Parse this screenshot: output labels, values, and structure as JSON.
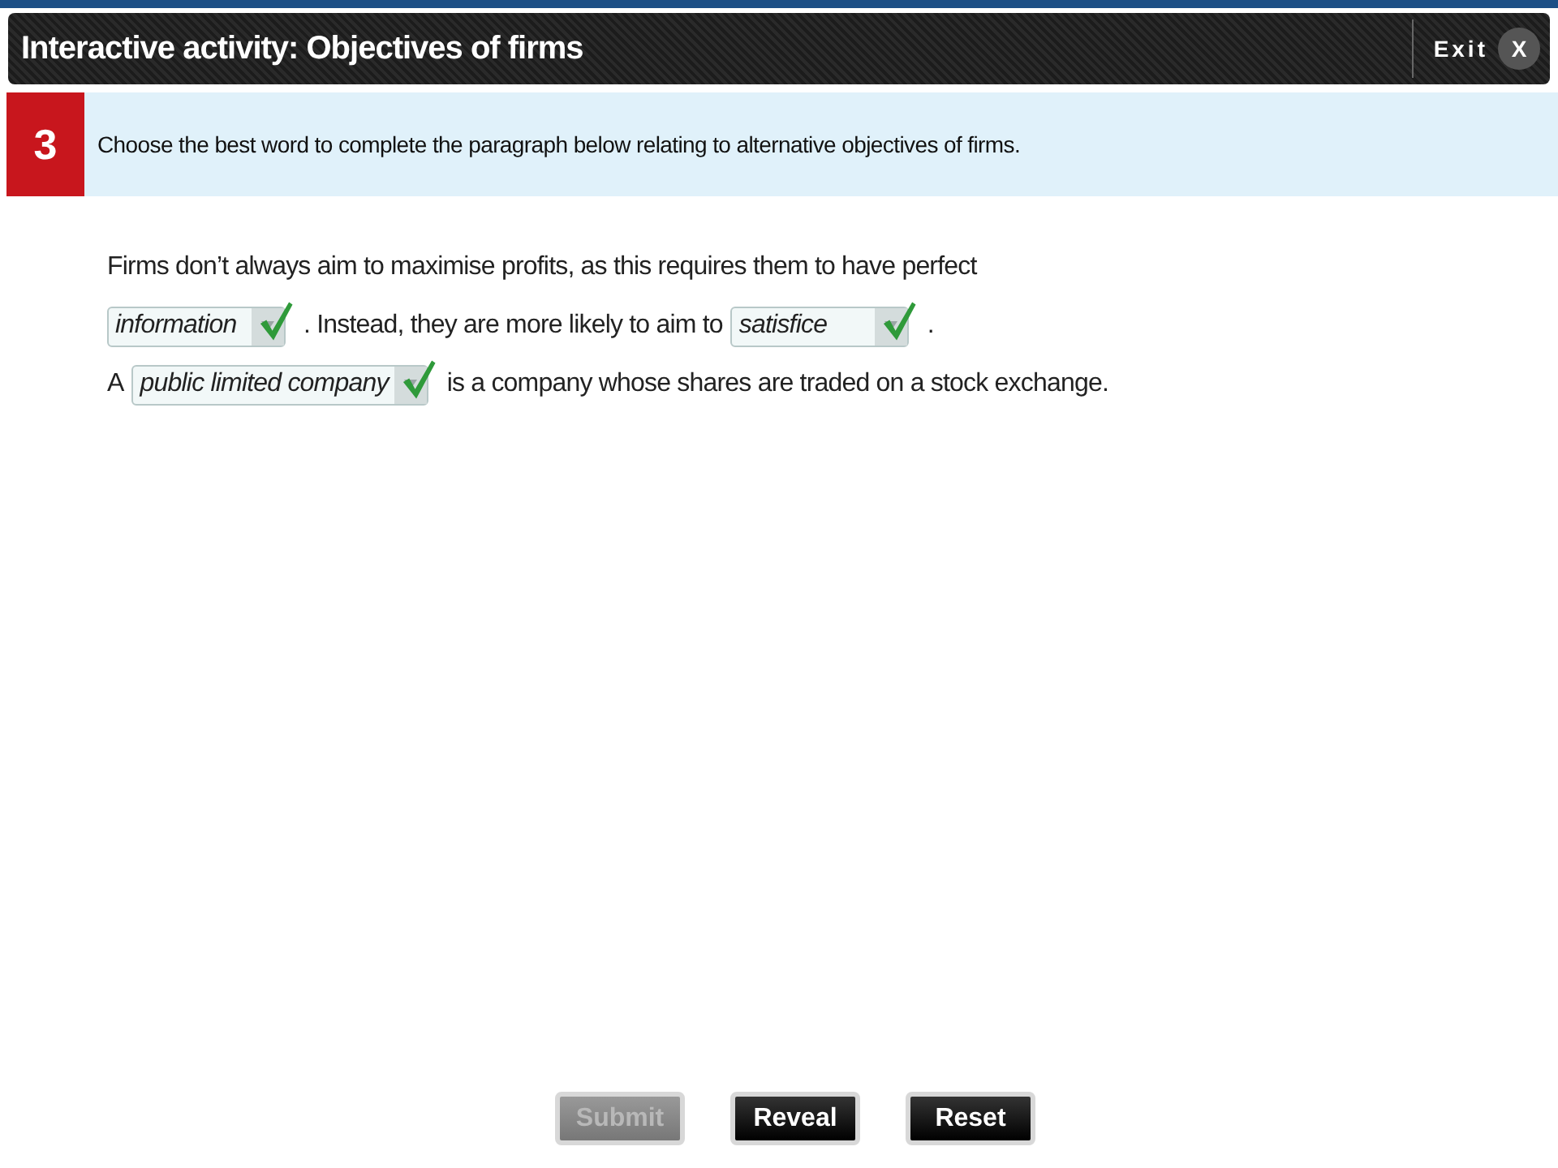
{
  "header": {
    "title": "Interactive activity: Objectives of firms",
    "exit_label": "Exit",
    "close_label": "X"
  },
  "question": {
    "number": "3",
    "instruction": "Choose the best word to complete the paragraph below relating to alternative objectives of firms."
  },
  "paragraph": [
    [
      {
        "kind": "text",
        "text": "Firms don’t always aim to maximise profits, as this requires them to have perfect"
      }
    ],
    [
      {
        "kind": "dropdown",
        "value": "information",
        "correct": true
      },
      {
        "kind": "text",
        "text": ". Instead, they are more likely to aim to"
      },
      {
        "kind": "dropdown",
        "value": "satisfice",
        "correct": true
      },
      {
        "kind": "text",
        "text": "."
      }
    ],
    [
      {
        "kind": "text",
        "text": "A"
      },
      {
        "kind": "dropdown",
        "value": "public limited company",
        "correct": true
      },
      {
        "kind": "text",
        "text": "is a company whose shares are traded on a stock exchange."
      }
    ]
  ],
  "buttons": [
    {
      "label": "Submit",
      "disabled": true
    },
    {
      "label": "Reveal",
      "disabled": false
    },
    {
      "label": "Reset",
      "disabled": false
    }
  ]
}
